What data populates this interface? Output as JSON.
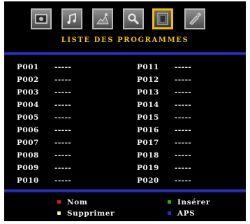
{
  "menu": {
    "title": "LISTE DES PROGRAMMES",
    "icons": [
      "picture-icon",
      "sound-icon",
      "feature-icon",
      "install-icon",
      "program-list-icon",
      "source-icon"
    ],
    "active_icon": "program-list-icon"
  },
  "programs": {
    "left": [
      {
        "number": "P001",
        "name": "-----"
      },
      {
        "number": "P002",
        "name": "-----"
      },
      {
        "number": "P003",
        "name": "-----"
      },
      {
        "number": "P004",
        "name": "-----"
      },
      {
        "number": "P005",
        "name": "-----"
      },
      {
        "number": "P006",
        "name": "-----"
      },
      {
        "number": "P007",
        "name": "-----"
      },
      {
        "number": "P008",
        "name": "-----"
      },
      {
        "number": "P009",
        "name": "-----"
      },
      {
        "number": "P010",
        "name": "-----"
      }
    ],
    "right": [
      {
        "number": "P011",
        "name": "-----"
      },
      {
        "number": "P012",
        "name": "-----"
      },
      {
        "number": "P013",
        "name": "-----"
      },
      {
        "number": "P014",
        "name": "-----"
      },
      {
        "number": "P015",
        "name": "-----"
      },
      {
        "number": "P016",
        "name": "-----"
      },
      {
        "number": "P017",
        "name": "-----"
      },
      {
        "number": "P018",
        "name": "-----"
      },
      {
        "number": "P019",
        "name": "-----"
      },
      {
        "number": "P020",
        "name": "-----"
      }
    ]
  },
  "legend": {
    "red": {
      "label": "Nom",
      "color": "#e01818"
    },
    "green": {
      "label": "Insérer",
      "color": "#18b428"
    },
    "yellow": {
      "label": "Supprimer",
      "color": "#f0e8a0"
    },
    "blue": {
      "label": "APS",
      "color": "#2030c8"
    }
  },
  "colors": {
    "background": "#000000",
    "title": "#f2c000",
    "text": "#f1f1f1",
    "divider": "#2f3dd0",
    "active_border": "#f2c000"
  }
}
